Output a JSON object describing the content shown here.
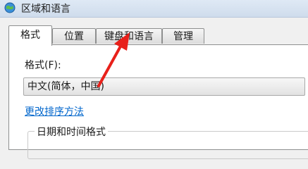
{
  "window": {
    "title": "区域和语言"
  },
  "tabs": [
    {
      "label": "格式",
      "active": true
    },
    {
      "label": "位置",
      "active": false
    },
    {
      "label": "键盘和语言",
      "active": false
    },
    {
      "label": "管理",
      "active": false
    }
  ],
  "format": {
    "label": "格式(F):",
    "selected": "中文(简体，中国)"
  },
  "sort_link": "更改排序方法",
  "datetime_group": {
    "title": "日期和时间格式"
  },
  "annotation": {
    "arrow_color": "#e8201a"
  }
}
